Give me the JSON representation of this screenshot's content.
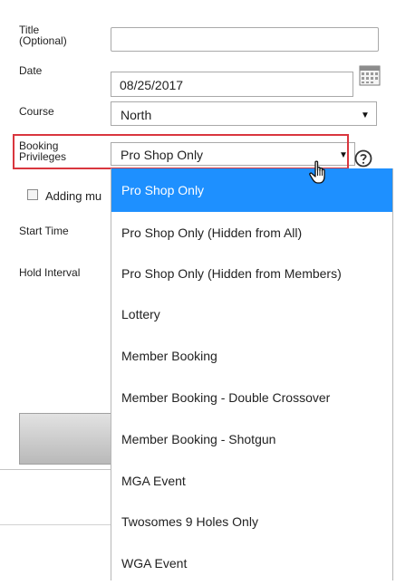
{
  "form": {
    "title_label": "Title\n(Optional)",
    "title_value": "",
    "date_label": "Date",
    "date_value": "08/25/2017",
    "course_label": "Course",
    "course_value": "North",
    "booking_label": "Booking\nPrivileges",
    "booking_value": "Pro Shop Only",
    "adding_label": "Adding mu",
    "start_time_label": "Start Time",
    "hold_interval_label": "Hold Interval"
  },
  "dropdown": {
    "options": [
      "Pro Shop Only",
      "Pro Shop Only (Hidden from All)",
      "Pro Shop Only (Hidden from Members)",
      "Lottery",
      "Member Booking",
      "Member Booking - Double Crossover",
      "Member Booking - Shotgun",
      "MGA Event",
      "Twosomes 9 Holes Only",
      "WGA Event"
    ],
    "selected_index": 0
  },
  "icons": {
    "calendar": "calendar-icon",
    "help": "help-icon",
    "cursor": "hand-cursor-icon",
    "caret": "dropdown-arrow-icon"
  },
  "colors": {
    "highlight_border": "#d9363e",
    "selected_option_bg": "#1e90ff"
  }
}
